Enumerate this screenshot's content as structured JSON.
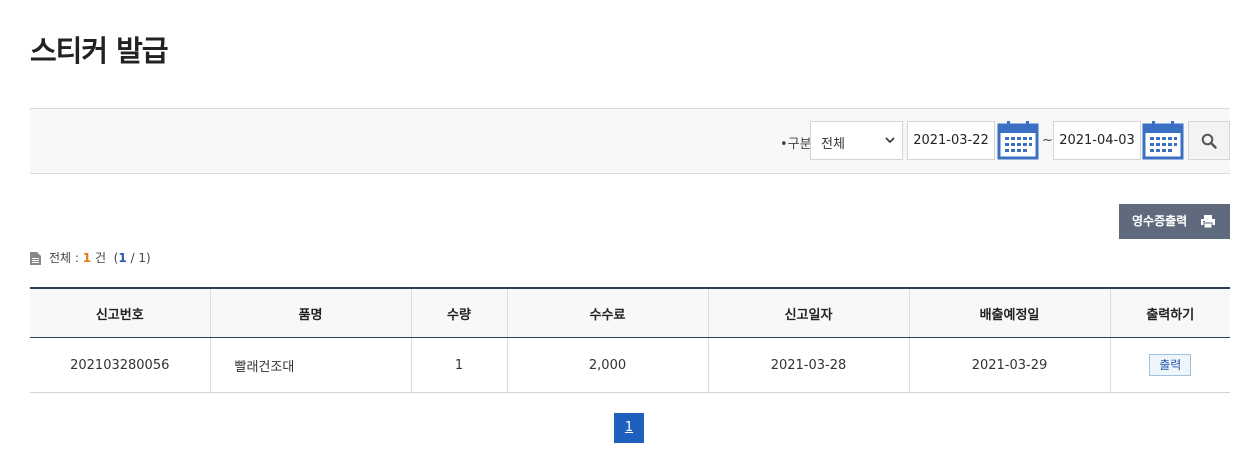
{
  "page": {
    "title": "스티커 발급"
  },
  "filter": {
    "label": "•구분",
    "category_selected": "전체",
    "date_from": "2021-03-22",
    "date_separator": "~",
    "date_to": "2021-04-03"
  },
  "actions": {
    "receipt_label": "영수증출력"
  },
  "summary": {
    "total_label": "전체 :",
    "total_count": "1",
    "unit": "건",
    "paren_open": "(",
    "current_page": "1",
    "page_sep": " / 1)"
  },
  "table": {
    "headers": [
      "신고번호",
      "품명",
      "수량",
      "수수료",
      "신고일자",
      "배출예정일",
      "출력하기"
    ],
    "rows": [
      {
        "report_no": "202103280056",
        "item": "빨래건조대",
        "qty": "1",
        "fee": "2,000",
        "report_date": "2021-03-28",
        "disposal_date": "2021-03-29",
        "print_label": "출력"
      }
    ]
  },
  "pagination": {
    "pages": [
      "1"
    ],
    "current": "1"
  },
  "colors": {
    "accent": "#1f5fbd",
    "header_line": "#2d3e55",
    "receipt_button": "#5f6b7c",
    "count_highlight": "#e27a20",
    "calendar_icon": "#3a6fc4"
  }
}
